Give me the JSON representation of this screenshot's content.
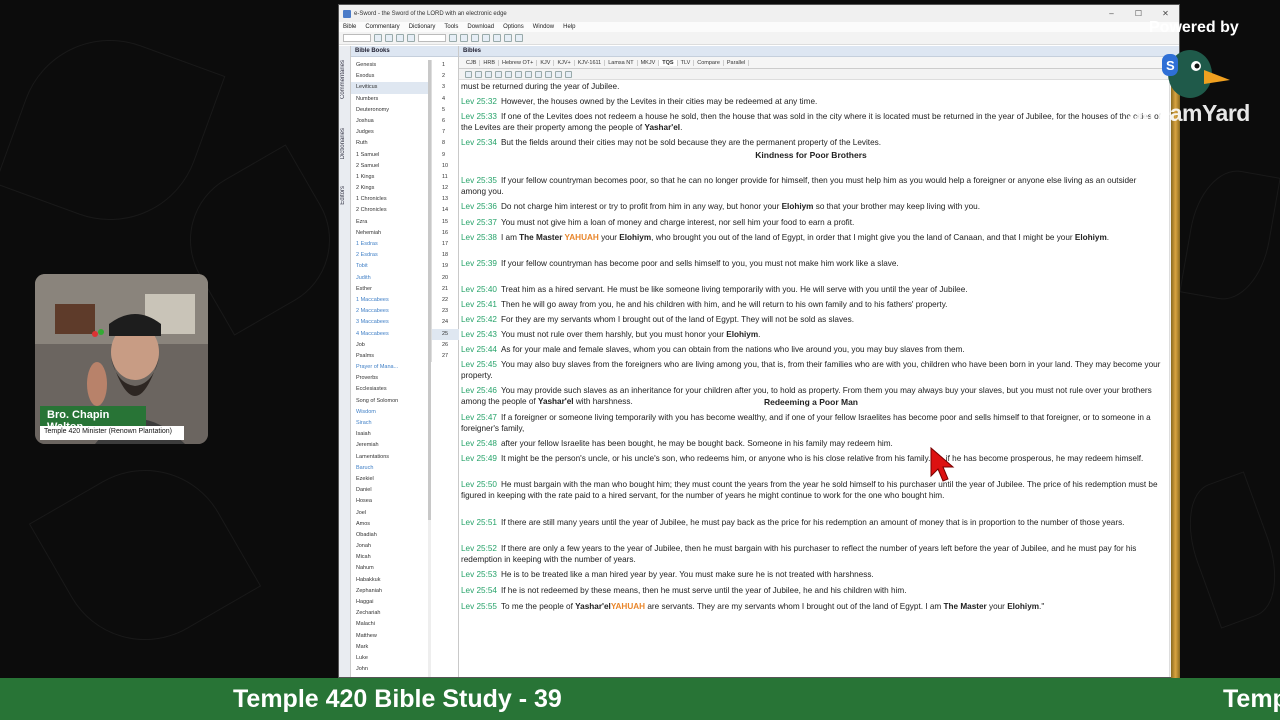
{
  "window": {
    "title": "e-Sword - the Sword of the LORD with an electronic edge",
    "menu": [
      "Bible",
      "Commentary",
      "Dictionary",
      "Tools",
      "Download",
      "Options",
      "Window",
      "Help"
    ],
    "controls": [
      "–",
      "☐",
      "✕"
    ]
  },
  "sidebar_tabs": [
    "Commentaries",
    "Dictionaries",
    "Editors"
  ],
  "books_panel": {
    "title": "Bible Books",
    "books": [
      "Genesis",
      "Exodus",
      "Leviticus",
      "Numbers",
      "Deuteronomy",
      "Joshua",
      "Judges",
      "Ruth",
      "1 Samuel",
      "2 Samuel",
      "1 Kings",
      "2 Kings",
      "1 Chronicles",
      "2 Chronicles",
      "Ezra",
      "Nehemiah",
      "1 Esdras",
      "2 Esdras",
      "Tobit",
      "Judith",
      "Esther",
      "1 Maccabees",
      "2 Maccabees",
      "3 Maccabees",
      "4 Maccabees",
      "Job",
      "Psalms",
      "Prayer of Mana...",
      "Proverbs",
      "Ecclesiastes",
      "Song of Solomon",
      "Wisdom",
      "Sirach",
      "Isaiah",
      "Jeremiah",
      "Lamentations",
      "Baruch",
      "Ezekiel",
      "Daniel",
      "Hosea",
      "Joel",
      "Amos",
      "Obadiah",
      "Jonah",
      "Micah",
      "Nahum",
      "Habakkuk",
      "Zephaniah",
      "Haggai",
      "Zechariah",
      "Malachi",
      "Matthew",
      "Mark",
      "Luke",
      "John"
    ],
    "apocrypha": [
      "1 Esdras",
      "2 Esdras",
      "Tobit",
      "Judith",
      "1 Maccabees",
      "2 Maccabees",
      "3 Maccabees",
      "4 Maccabees",
      "Prayer of Mana...",
      "Wisdom",
      "Sirach",
      "Baruch"
    ],
    "selected_book": "Leviticus",
    "chapters": [
      "1",
      "2",
      "3",
      "4",
      "5",
      "6",
      "7",
      "8",
      "9",
      "10",
      "11",
      "12",
      "13",
      "14",
      "15",
      "16",
      "17",
      "18",
      "19",
      "20",
      "21",
      "22",
      "23",
      "24",
      "25",
      "26",
      "27"
    ],
    "selected_chapter": "25"
  },
  "bible_panel": {
    "title": "Bibles",
    "tabs": [
      "CJB",
      "HRB",
      "Hebrew OT+",
      "KJV",
      "KJV+",
      "KJV-1611",
      "Lamsa NT",
      "MKJV",
      "TQS",
      "TLV",
      "Compare",
      "Parallel"
    ],
    "active_tab": "TQS"
  },
  "verses": [
    {
      "ref": "",
      "text": "must be returned during the year of Jubilee."
    },
    {
      "ref": "Lev 25:32",
      "text": "However, the houses owned by the Levites in their cities may be redeemed at any time."
    },
    {
      "ref": "Lev 25:33",
      "text": "If one of the Levites does not redeem a house he sold, then the house that was sold in the city where it is located must be returned in the year of Jubilee, for the houses of the cities of the Levites are their property among the people of ",
      "b1": "Yashar'el",
      "t2": "."
    },
    {
      "ref": "Lev 25:34",
      "text": "But the fields around their cities may not be sold because they are the permanent property of the Levites."
    },
    {
      "ref": "Lev 25:35",
      "text": "If your fellow countryman becomes poor, so that he can no longer provide for himself, then you must help him as you would help a foreigner or anyone else living as an outsider among you."
    },
    {
      "ref": "Lev 25:36",
      "text": "Do not charge him interest or try to profit from him in any way, but honor your ",
      "b1": "Elohiym",
      "t2": " so that your brother may keep living with you."
    },
    {
      "ref": "Lev 25:37",
      "text": "You must not give him a loan of money and charge interest, nor sell him your food to earn a profit."
    },
    {
      "ref": "Lev 25:38",
      "text": "I am ",
      "b1": "The Master ",
      "y1": "YAHUAH",
      "t2": " your ",
      "b2": "Elohiym",
      "t3": ", who brought you out of the land of Egypt, in order that I might give you the land of Canaan, and that I might be your ",
      "b3": "Elohiym",
      "t4": "."
    },
    {
      "ref": "Lev 25:39",
      "text": "If your fellow countryman has become poor and sells himself to you, you must not make him work like a slave."
    },
    {
      "ref": "Lev 25:40",
      "text": "Treat him as a hired servant. He must be like someone living temporarily with you. He will serve with you until the year of Jubilee."
    },
    {
      "ref": "Lev 25:41",
      "text": "Then he will go away from you, he and his children with him, and he will return to his own family and to his fathers' property."
    },
    {
      "ref": "Lev 25:42",
      "text": "For they are my servants whom I brought out of the land of Egypt. They will not be sold as slaves."
    },
    {
      "ref": "Lev 25:43",
      "text": "You must not rule over them harshly, but you must honor your ",
      "b1": "Elohiym",
      "t2": "."
    },
    {
      "ref": "Lev 25:44",
      "text": "As for your male and female slaves, whom you can obtain from the nations who live around you, you may buy slaves from them."
    },
    {
      "ref": "Lev 25:45",
      "text": "You may also buy slaves from the foreigners who are living among you, that is, from their families who are with you, children who have been born in your land. They may become your property."
    },
    {
      "ref": "Lev 25:46",
      "text": "You may provide such slaves as an inheritance for your children after you, to hold as property. From them you may always buy your slaves, but you must not rule over your brothers among the people of ",
      "b1": "Yashar'el",
      "t2": " with harshness."
    },
    {
      "ref": "Lev 25:47",
      "text": "If a foreigner or someone living temporarily with you has become wealthy, and if one of your fellow Israelites has become poor and sells himself to that foreigner, or to someone in a foreigner's family,"
    },
    {
      "ref": "Lev 25:48",
      "text": "after your fellow Israelite has been bought, he may be bought back. Someone in his family may redeem him."
    },
    {
      "ref": "Lev 25:49",
      "text": "It might be the person's uncle, or his uncle's son, who redeems him, or anyone who is his close relative from his family. Or, if he has become prosperous, he may redeem himself."
    },
    {
      "ref": "Lev 25:50",
      "text": "He must bargain with the man who bought him; they must count the years from the year he sold himself to his purchaser until the year of Jubilee. The price of his redemption must be figured in keeping with the rate paid to a hired servant, for the number of years he might continue to work for the one who bought him."
    },
    {
      "ref": "Lev 25:51",
      "text": "If there are still many years until the year of Jubilee, he must pay back as the price for his redemption an amount of money that is in proportion to the number of those years."
    },
    {
      "ref": "Lev 25:52",
      "text": "If there are only a few years to the year of Jubilee, then he must bargain with his purchaser to reflect the number of years left before the year of Jubilee, and he must pay for his redemption in keeping with the number of years."
    },
    {
      "ref": "Lev 25:53",
      "text": "He is to be treated like a man hired year by year. You must make sure he is not treated with harshness."
    },
    {
      "ref": "Lev 25:54",
      "text": "If he is not redeemed by these means, then he must serve until the year of Jubilee, he and his children with him."
    },
    {
      "ref": "Lev 25:55",
      "text": "To me the people of ",
      "b1": "Yashar'el",
      "t2": " are servants. They are my servants whom I brought out of the land of Egypt. I am ",
      "b2": "The Master ",
      "y1": "YAHUAH",
      "t3": " your ",
      "b3": "Elohiym",
      "t4": ".\""
    }
  ],
  "headings": [
    "Kindness for Poor Brothers",
    "Redeeming a Poor Man"
  ],
  "overlay": {
    "powered_by": "Powered by",
    "brand": "StreamYard",
    "presenter_name": "Bro. Chapin Walton",
    "presenter_title": "Temple 420 Minister (Renown Plantation)",
    "ticker": "Temple 420 Bible Study - 39",
    "ticker_repeat": "Temp"
  },
  "colors": {
    "verse_ref": "#27a36a",
    "divine_name": "#e8852a",
    "ticker_bg": "#287436",
    "apocrypha_book": "#3f7fc6"
  }
}
